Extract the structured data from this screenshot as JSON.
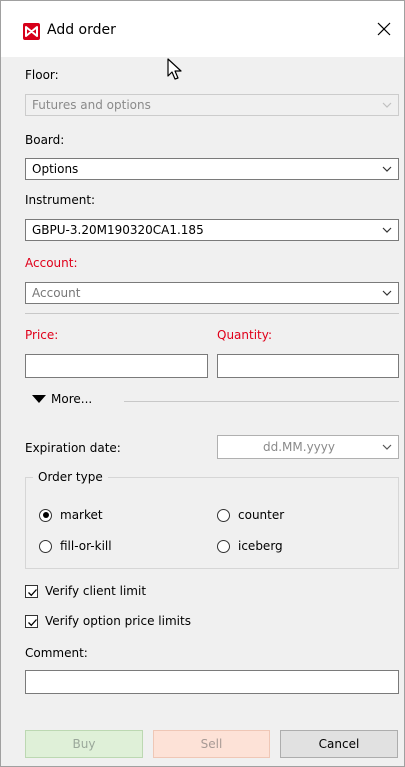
{
  "window": {
    "title": "Add order",
    "close_icon": "close-icon",
    "app_icon": "order-app-icon"
  },
  "form": {
    "floor": {
      "label": "Floor:",
      "value": "Futures and options",
      "disabled": true
    },
    "board": {
      "label": "Board:",
      "value": "Options"
    },
    "instrument": {
      "label": "Instrument:",
      "value": "GBPU-3.20M190320CA1.185"
    },
    "account": {
      "label": "Account:",
      "placeholder": "Account",
      "required_color": "#e0001a"
    },
    "price": {
      "label": "Price:",
      "value": ""
    },
    "quantity": {
      "label": "Quantity:",
      "value": ""
    },
    "more_label": "More...",
    "expiration": {
      "label": "Expiration date:",
      "placeholder": "dd.MM.yyyy"
    },
    "order_type": {
      "title": "Order type",
      "options": [
        {
          "label": "market",
          "selected": true
        },
        {
          "label": "counter",
          "selected": false
        },
        {
          "label": "fill-or-kill",
          "selected": false
        },
        {
          "label": "iceberg",
          "selected": false
        }
      ]
    },
    "verify_client_limit": {
      "label": "Verify client limit",
      "checked": true
    },
    "verify_option_price_limits": {
      "label": "Verify option price limits",
      "checked": true
    },
    "comment": {
      "label": "Comment:",
      "value": ""
    }
  },
  "buttons": {
    "buy": "Buy",
    "sell": "Sell",
    "cancel": "Cancel"
  },
  "colors": {
    "buy_bg": "#dff0d8",
    "sell_bg": "#fde2d7",
    "accent_red": "#d7001a"
  }
}
